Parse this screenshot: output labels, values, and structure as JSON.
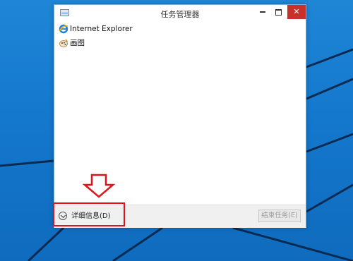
{
  "window": {
    "title": "任务管理器",
    "close_glyph": "✕"
  },
  "app_list": [
    {
      "name": "Internet Explorer",
      "icon": "ie-icon"
    },
    {
      "name": "画图",
      "icon": "paint-icon"
    }
  ],
  "footer": {
    "more_details_label": "详细信息(D)",
    "end_task_label": "结束任务(E)"
  },
  "colors": {
    "desktop": "#1478cc",
    "annotation": "#e0141b",
    "close_button": "#c7302b"
  }
}
